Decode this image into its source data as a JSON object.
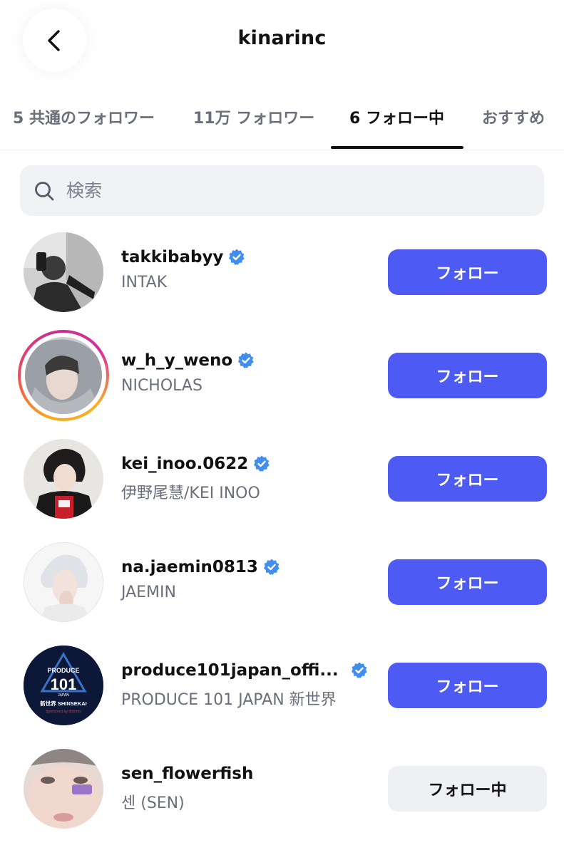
{
  "header": {
    "title": "kinarinc",
    "back_icon": "chevron-left-icon"
  },
  "tabs": [
    {
      "label": "5 共通のフォロワー",
      "active": false
    },
    {
      "label": "11万 フォロワー",
      "active": false
    },
    {
      "label": "6 フォロー中",
      "active": true
    },
    {
      "label": "おすすめ",
      "active": false
    }
  ],
  "search": {
    "placeholder": "検索",
    "value": ""
  },
  "accounts": [
    {
      "username": "takkibabyy",
      "name": "INTAK",
      "verified": true,
      "story": false,
      "button": "フォロー",
      "following": false
    },
    {
      "username": "w_h_y_weno",
      "name": "NICHOLAS",
      "verified": true,
      "story": true,
      "button": "フォロー",
      "following": false
    },
    {
      "username": "kei_inoo.0622",
      "name": "伊野尾慧/KEI INOO",
      "verified": true,
      "story": false,
      "button": "フォロー",
      "following": false
    },
    {
      "username": "na.jaemin0813",
      "name": "JAEMIN",
      "verified": true,
      "story": false,
      "button": "フォロー",
      "following": false
    },
    {
      "username": "produce101japan_offi...",
      "name": "PRODUCE 101 JAPAN 新世界",
      "verified": true,
      "story": false,
      "button": "フォロー",
      "following": false
    },
    {
      "username": "sen_flowerfish",
      "name": "센 (SEN)",
      "verified": false,
      "story": false,
      "button": "フォロー中",
      "following": true
    }
  ],
  "logo_text": {
    "produce": "PRODUCE",
    "number": "101",
    "japan": "JAPAN",
    "sub": "新世界 SHINSEKAI",
    "sponsor": "Sponsored by docomo"
  },
  "colors": {
    "follow_button": "#4d5af3",
    "following_button": "#eff0f4",
    "verified_badge": "#3f8ef0",
    "secondary_text": "#6b6f7b"
  }
}
